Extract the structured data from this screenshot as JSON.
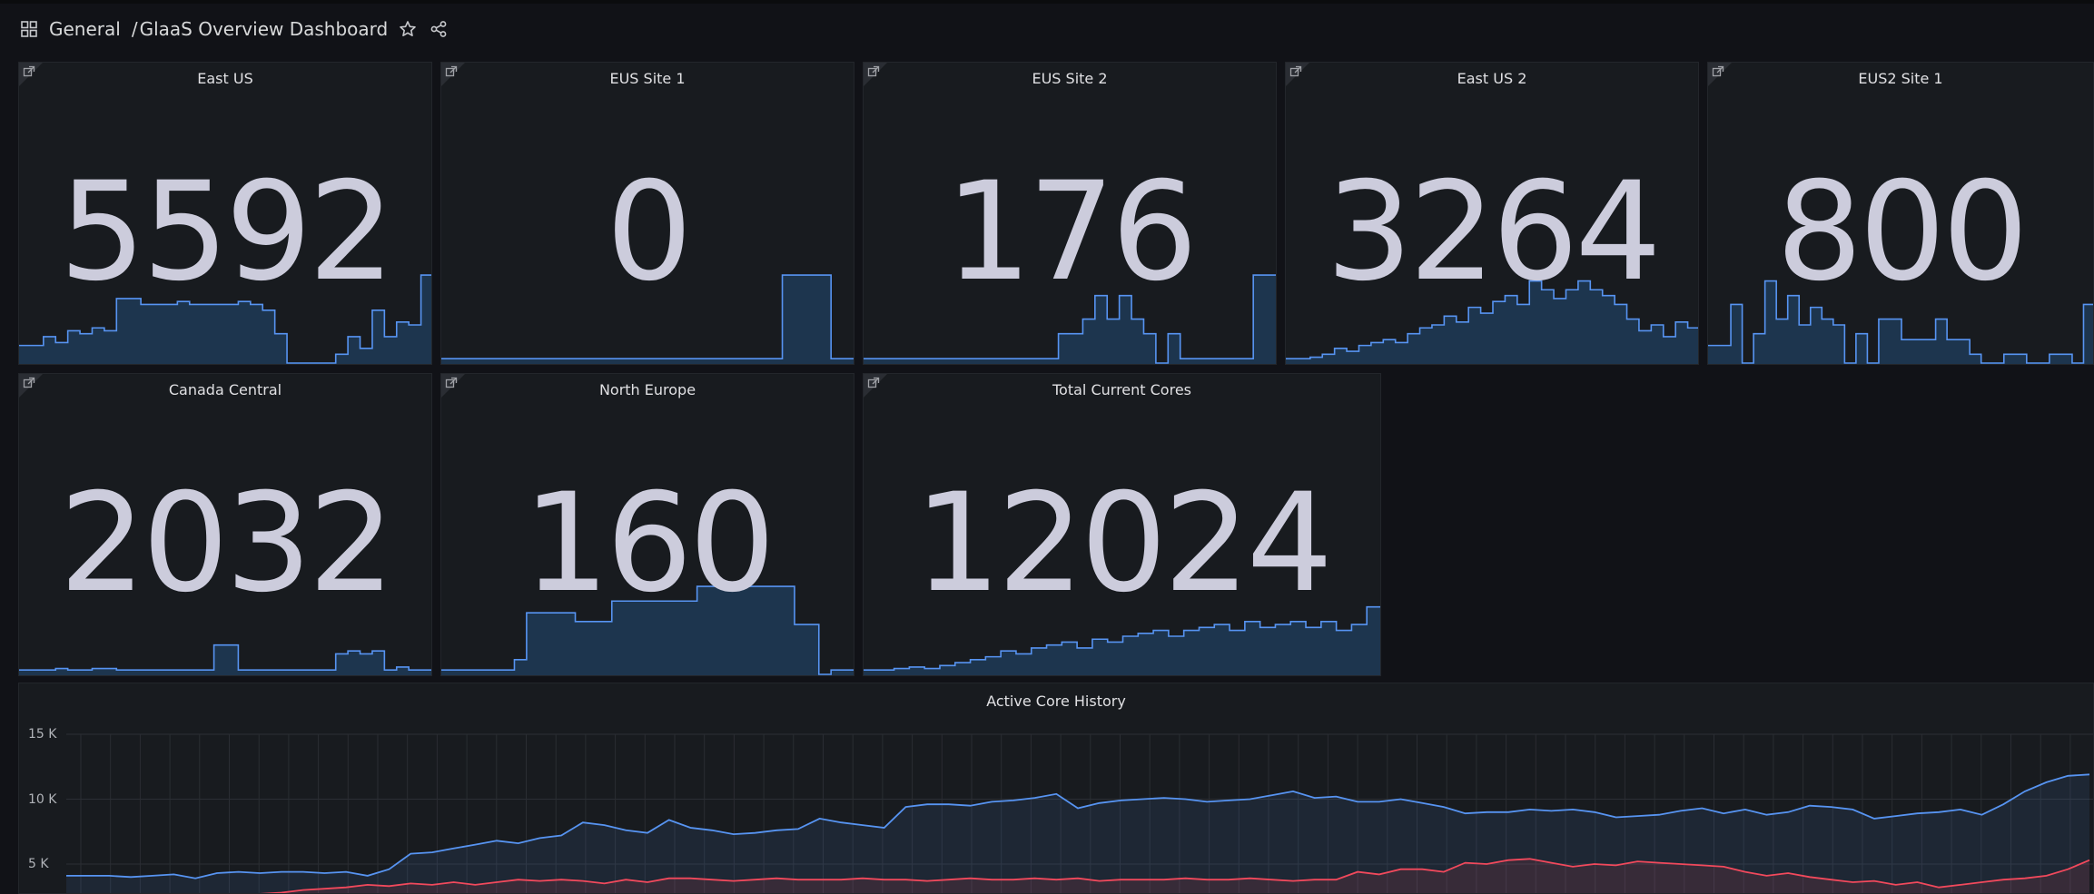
{
  "breadcrumb": {
    "folder": "General",
    "separator": "/",
    "dashboard": "GlaaS Overview Dashboard"
  },
  "icons": {
    "apps": "grid-icon",
    "star": "star-icon",
    "share": "share-icon",
    "panel_link": "external-link-icon"
  },
  "colors": {
    "background": "#111217",
    "panel": "#181b1f",
    "value_text": "#ccccdc",
    "series_blue": "#5794f2",
    "spark_fill": "#1f3a57",
    "series_red": "#f2495c"
  },
  "stat_panels": [
    {
      "title": "East US",
      "value": "5592",
      "spark": [
        0.12,
        0.12,
        0.18,
        0.14,
        0.22,
        0.2,
        0.24,
        0.22,
        0.44,
        0.44,
        0.4,
        0.4,
        0.4,
        0.42,
        0.4,
        0.4,
        0.4,
        0.4,
        0.42,
        0.4,
        0.36,
        0.2,
        0.0,
        0.0,
        0.0,
        0.0,
        0.06,
        0.18,
        0.1,
        0.36,
        0.18,
        0.28,
        0.26,
        0.6,
        0.6
      ]
    },
    {
      "title": "EUS Site 1",
      "value": "0",
      "spark": [
        0.03,
        0.03,
        0.03,
        0.03,
        0.03,
        0.03,
        0.03,
        0.03,
        0.03,
        0.03,
        0.03,
        0.03,
        0.03,
        0.03,
        0.03,
        0.03,
        0.03,
        0.03,
        0.03,
        0.03,
        0.03,
        0.03,
        0.03,
        0.03,
        0.03,
        0.03,
        0.03,
        0.03,
        0.6,
        0.6,
        0.6,
        0.6,
        0.03,
        0.03,
        0.03
      ]
    },
    {
      "title": "EUS Site 2",
      "value": "176",
      "spark": [
        0.03,
        0.03,
        0.03,
        0.03,
        0.03,
        0.03,
        0.03,
        0.03,
        0.03,
        0.03,
        0.03,
        0.03,
        0.03,
        0.03,
        0.03,
        0.03,
        0.2,
        0.2,
        0.3,
        0.46,
        0.3,
        0.46,
        0.3,
        0.2,
        0.0,
        0.2,
        0.03,
        0.03,
        0.03,
        0.03,
        0.03,
        0.03,
        0.6,
        0.6,
        0.6
      ]
    },
    {
      "title": "East US 2",
      "value": "3264",
      "spark": [
        0.03,
        0.03,
        0.04,
        0.06,
        0.1,
        0.08,
        0.12,
        0.14,
        0.16,
        0.14,
        0.2,
        0.24,
        0.26,
        0.32,
        0.28,
        0.38,
        0.34,
        0.42,
        0.46,
        0.4,
        0.56,
        0.5,
        0.44,
        0.5,
        0.56,
        0.5,
        0.46,
        0.4,
        0.3,
        0.22,
        0.26,
        0.18,
        0.28,
        0.24,
        0.3
      ]
    },
    {
      "title": "EUS2 Site 1",
      "value": "800",
      "spark": [
        0.12,
        0.12,
        0.4,
        0.0,
        0.2,
        0.56,
        0.3,
        0.46,
        0.26,
        0.38,
        0.3,
        0.26,
        0.0,
        0.2,
        0.0,
        0.3,
        0.3,
        0.16,
        0.16,
        0.16,
        0.3,
        0.16,
        0.16,
        0.06,
        0.0,
        0.0,
        0.06,
        0.06,
        0.0,
        0.0,
        0.06,
        0.06,
        0.0,
        0.4,
        0.34
      ]
    },
    {
      "title": "Canada Central",
      "value": "2032",
      "spark": [
        0.03,
        0.03,
        0.03,
        0.04,
        0.03,
        0.03,
        0.04,
        0.04,
        0.03,
        0.03,
        0.03,
        0.03,
        0.03,
        0.03,
        0.03,
        0.03,
        0.2,
        0.2,
        0.03,
        0.03,
        0.03,
        0.03,
        0.03,
        0.03,
        0.03,
        0.03,
        0.14,
        0.16,
        0.14,
        0.16,
        0.03,
        0.05,
        0.03,
        0.03,
        0.6
      ]
    },
    {
      "title": "North Europe",
      "value": "160",
      "spark": [
        0.03,
        0.03,
        0.03,
        0.03,
        0.03,
        0.03,
        0.1,
        0.42,
        0.42,
        0.42,
        0.42,
        0.36,
        0.36,
        0.36,
        0.5,
        0.5,
        0.5,
        0.5,
        0.5,
        0.5,
        0.5,
        0.6,
        0.6,
        0.6,
        0.6,
        0.6,
        0.6,
        0.6,
        0.6,
        0.34,
        0.34,
        0.0,
        0.03,
        0.03,
        0.03
      ]
    },
    {
      "title": "Total Current Cores",
      "value": "12024",
      "spark": [
        0.03,
        0.03,
        0.04,
        0.05,
        0.04,
        0.06,
        0.08,
        0.1,
        0.12,
        0.16,
        0.14,
        0.18,
        0.2,
        0.22,
        0.18,
        0.24,
        0.22,
        0.26,
        0.28,
        0.3,
        0.26,
        0.3,
        0.32,
        0.34,
        0.3,
        0.36,
        0.32,
        0.34,
        0.36,
        0.32,
        0.36,
        0.3,
        0.34,
        0.46,
        0.6
      ]
    }
  ],
  "history": {
    "title": "Active Core History",
    "y_labels": [
      "15 K",
      "10 K",
      "5 K"
    ]
  },
  "chart_data": {
    "type": "area",
    "title": "Active Core History",
    "ylim": [
      0,
      15000
    ],
    "y_ticks": [
      5000,
      10000,
      15000
    ],
    "grid": true,
    "series": [
      {
        "color": "#5794f2",
        "values": [
          4100,
          4100,
          4100,
          4000,
          4100,
          4200,
          3900,
          4300,
          4400,
          4300,
          4400,
          4400,
          4300,
          4400,
          4100,
          4600,
          5800,
          5900,
          6200,
          6500,
          6800,
          6600,
          7000,
          7200,
          8200,
          8000,
          7600,
          7400,
          8400,
          7800,
          7600,
          7300,
          7400,
          7600,
          7700,
          8500,
          8200,
          8000,
          7800,
          9400,
          9600,
          9600,
          9500,
          9800,
          9900,
          10100,
          10400,
          9300,
          9700,
          9900,
          10000,
          10100,
          10000,
          9800,
          9900,
          10000,
          10300,
          10600,
          10100,
          10200,
          9800,
          9800,
          10000,
          9700,
          9400,
          8900,
          9000,
          9000,
          9200,
          9100,
          9200,
          9000,
          8600,
          8700,
          8800,
          9100,
          9300,
          8900,
          9200,
          8800,
          9000,
          9500,
          9400,
          9200,
          8500,
          8700,
          8900,
          9000,
          9200,
          8800,
          9600,
          10600,
          11300,
          11800,
          11900
        ]
      },
      {
        "color": "#f2495c",
        "values": [
          2000,
          2000,
          2000,
          2100,
          2300,
          2300,
          2400,
          2400,
          2500,
          2700,
          2800,
          3000,
          3100,
          3200,
          3400,
          3300,
          3500,
          3400,
          3600,
          3400,
          3600,
          3800,
          3700,
          3800,
          3700,
          3500,
          3800,
          3600,
          3900,
          3900,
          3800,
          3700,
          3800,
          3900,
          3800,
          3800,
          3800,
          3900,
          3800,
          3800,
          3700,
          3800,
          3900,
          3800,
          3800,
          3900,
          3800,
          3900,
          3700,
          3800,
          3800,
          3800,
          3900,
          3800,
          3800,
          3900,
          3800,
          3700,
          3800,
          3800,
          4400,
          4200,
          4600,
          4600,
          4400,
          5100,
          5000,
          5300,
          5400,
          5100,
          4800,
          5000,
          4900,
          5200,
          5100,
          5000,
          4900,
          4800,
          4400,
          4100,
          4300,
          4000,
          3800,
          3600,
          3700,
          3400,
          3600,
          3200,
          3400,
          3600,
          3800,
          3900,
          4100,
          4600,
          5300
        ]
      }
    ]
  }
}
